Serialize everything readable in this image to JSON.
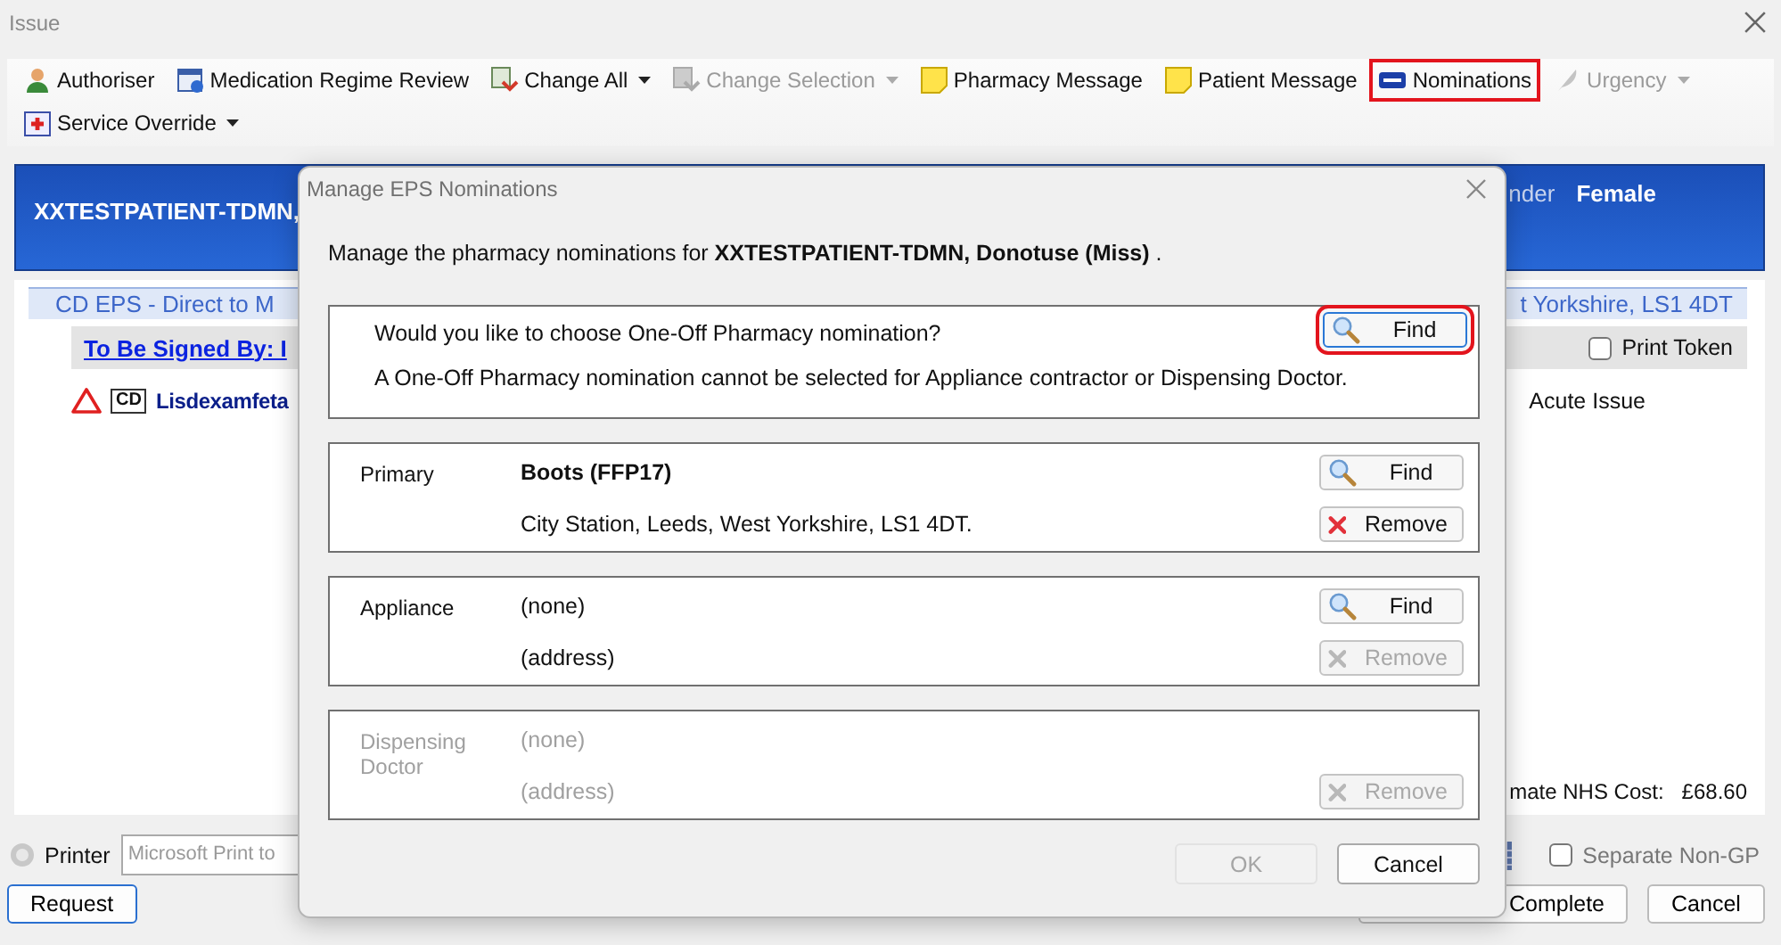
{
  "window": {
    "title": "Issue"
  },
  "toolbar_rows": [
    [
      {
        "kind": "person",
        "label": "Authoriser",
        "dropdown": false,
        "disabled": false,
        "highlighted": false
      },
      {
        "kind": "calendar",
        "label": "Medication Regime Review",
        "dropdown": false,
        "disabled": false,
        "highlighted": false
      },
      {
        "kind": "change",
        "label": "Change All",
        "dropdown": true,
        "disabled": false,
        "highlighted": false
      },
      {
        "kind": "change",
        "label": "Change Selection",
        "dropdown": true,
        "disabled": true,
        "highlighted": false
      },
      {
        "kind": "note",
        "label": "Pharmacy Message",
        "dropdown": false,
        "disabled": false,
        "highlighted": false
      },
      {
        "kind": "note",
        "label": "Patient Message",
        "dropdown": false,
        "disabled": false,
        "highlighted": false
      },
      {
        "kind": "eps",
        "label": "Nominations",
        "dropdown": false,
        "disabled": false,
        "highlighted": true
      },
      {
        "kind": "urgency",
        "label": "Urgency",
        "dropdown": true,
        "disabled": true,
        "highlighted": false
      }
    ],
    [
      {
        "kind": "override",
        "label": "Service Override",
        "dropdown": true,
        "disabled": false,
        "highlighted": false
      }
    ]
  ],
  "patient_header": {
    "name": "XXTESTPATIENT-TDMN,",
    "gender_label": "nder",
    "gender": "Female"
  },
  "prescription": {
    "group_left": "CD EPS - Direct to M",
    "group_right": "t Yorkshire, LS1 4DT",
    "signed_by": "To Be Signed By: I",
    "print_token": {
      "label": "Print Token",
      "checked": false
    },
    "drug": {
      "badge": "CD",
      "name": "Lisdexamfeta",
      "issue_type": "Acute Issue"
    },
    "cost_label": "mate NHS Cost:",
    "cost": "£68.60"
  },
  "footer": {
    "printer": {
      "label": "Printer",
      "selected": false,
      "value": "Microsoft Print to"
    },
    "separate": {
      "label": "Separate Non-GP",
      "checked": false
    },
    "buttons": [
      {
        "kind": "request",
        "label": "Request"
      },
      {
        "kind": "complete",
        "label": "Complete"
      },
      {
        "kind": "cancel",
        "label": "Cancel"
      }
    ]
  },
  "dialog": {
    "title": "Manage EPS Nominations",
    "intro": "Manage the pharmacy nominations for **XXTESTPATIENT-TDMN, Donotuse (Miss)** .",
    "one_off": {
      "question": "Would you like to choose One-Off Pharmacy nomination?",
      "note": "A One-Off Pharmacy nomination cannot be selected for Appliance contractor or Dispensing Doctor.",
      "button": {
        "label": "Find",
        "highlighted": true
      }
    },
    "nominations": [
      {
        "label": "Primary",
        "name": "Boots (FFP17)",
        "address": "City Station, Leeds, West Yorkshire, LS1 4DT.",
        "disabled": false,
        "buttons": [
          {
            "kind": "find",
            "label": "Find",
            "disabled": false
          },
          {
            "kind": "remove",
            "label": "Remove",
            "disabled": false
          }
        ]
      },
      {
        "label": "Appliance",
        "name": "(none)",
        "address": "(address)",
        "disabled": false,
        "buttons": [
          {
            "kind": "find",
            "label": "Find",
            "disabled": false
          },
          {
            "kind": "remove",
            "label": "Remove",
            "disabled": true
          }
        ]
      },
      {
        "label": "Dispensing Doctor",
        "name": "(none)",
        "address": "(address)",
        "disabled": true,
        "buttons": [
          {
            "kind": "remove",
            "label": "Remove",
            "disabled": true
          }
        ]
      }
    ],
    "buttons": [
      {
        "label": "OK",
        "disabled": true
      },
      {
        "label": "Cancel",
        "disabled": false
      }
    ]
  }
}
